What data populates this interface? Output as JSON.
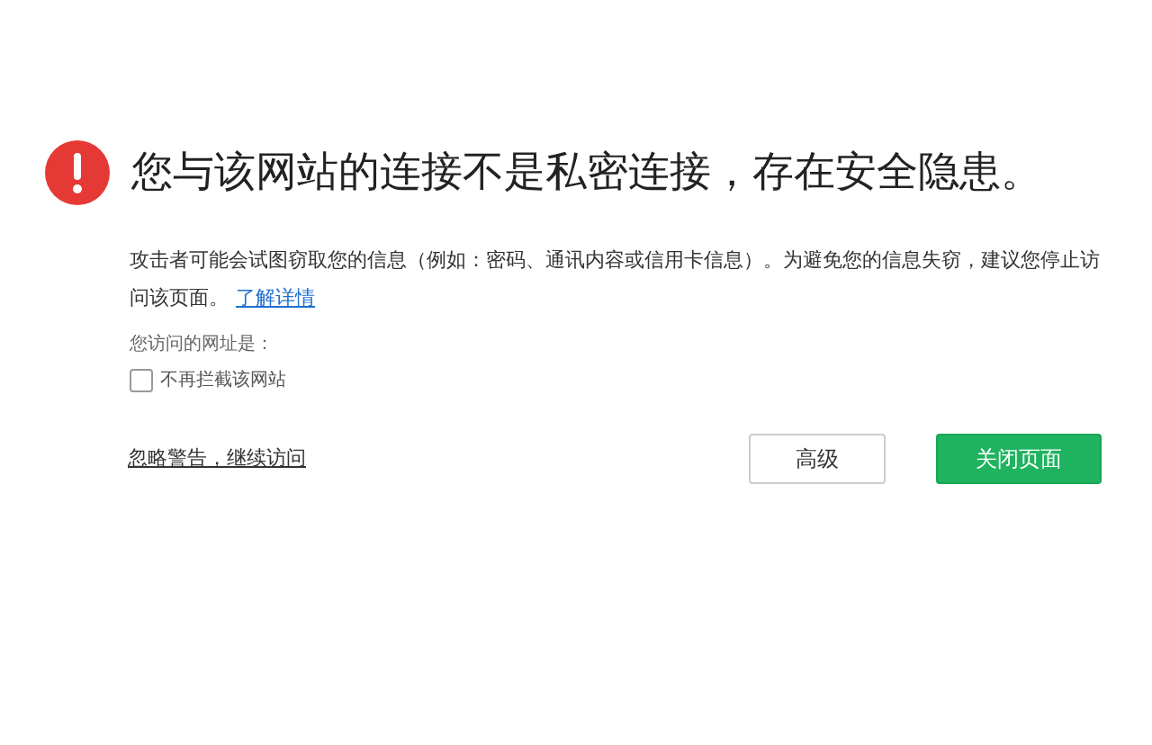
{
  "title": "您与该网站的连接不是私密连接，存在安全隐患。",
  "description": "攻击者可能会试图窃取您的信息（例如：密码、通讯内容或信用卡信息）。为避免您的信息失窃，建议您停止访问该页面。",
  "learn_more_link": "了解详情",
  "url_label": "您访问的网址是：",
  "checkbox": {
    "label": "不再拦截该网站",
    "checked": false
  },
  "ignore_link": "忽略警告，继续访问",
  "buttons": [
    {
      "label": "高级",
      "kind": "secondary"
    },
    {
      "label": "关闭页面",
      "kind": "primary"
    }
  ]
}
